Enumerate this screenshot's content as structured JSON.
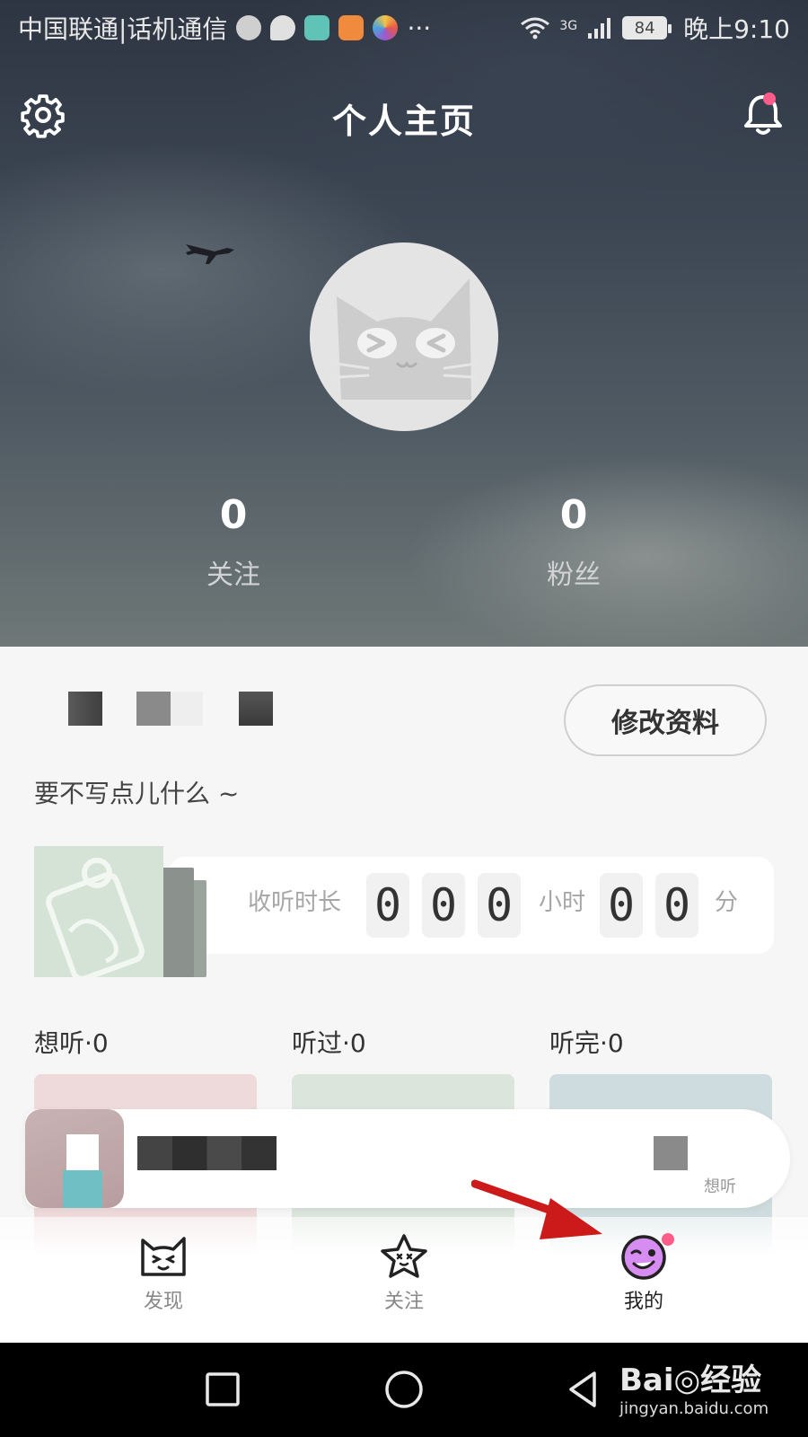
{
  "status_bar": {
    "carrier": "中国联通|话机通信",
    "network": "3G",
    "battery": "84",
    "time": "晚上9:10",
    "more": "···"
  },
  "header": {
    "title": "个人主页"
  },
  "stats": {
    "following_count": "0",
    "following_label": "关注",
    "fans_count": "0",
    "fans_label": "粉丝"
  },
  "profile": {
    "edit_button": "修改资料",
    "bio": "要不写点儿什么 ~"
  },
  "listening_time": {
    "label": "收听时长",
    "hours_digits": [
      "0",
      "0",
      "0"
    ],
    "hours_unit": "小时",
    "minutes_digits": [
      "0",
      "0"
    ],
    "minutes_unit": "分"
  },
  "lists": [
    {
      "label": "想听·0",
      "color": "#eedada"
    },
    {
      "label": "听过·0",
      "color": "#dbe5dc"
    },
    {
      "label": "听完·0",
      "color": "#cfdcdf"
    }
  ],
  "mini_player": {
    "action_label": "想听"
  },
  "tabs": [
    {
      "label": "发现",
      "icon": "cat-face-icon",
      "active": false
    },
    {
      "label": "关注",
      "icon": "star-face-icon",
      "active": false
    },
    {
      "label": "我的",
      "icon": "wink-face-icon",
      "active": true
    }
  ],
  "watermark": {
    "logo": "Bai◎经验",
    "url": "jingyan.baidu.com"
  },
  "colors": {
    "accent_pink": "#ff5c8a",
    "arrow_red": "#cc1a1a",
    "mine_purple": "#d68cf0"
  }
}
